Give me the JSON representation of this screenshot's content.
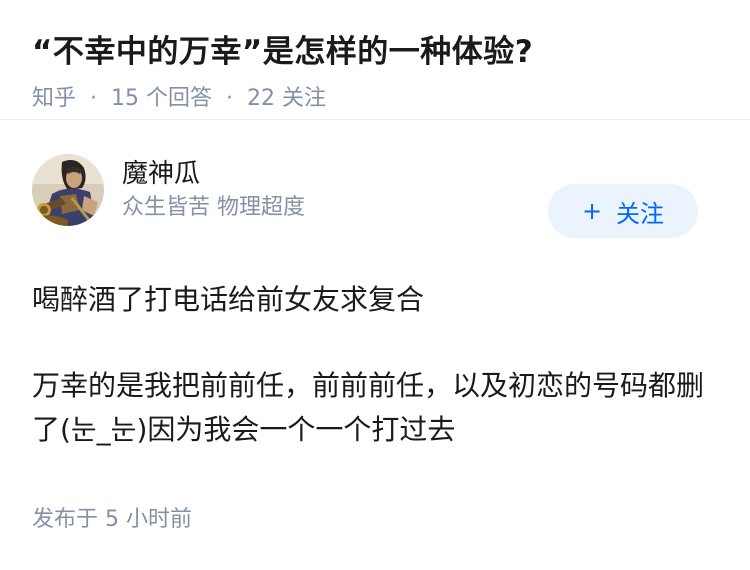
{
  "question": {
    "title": "“不幸中的万幸”是怎样的一种体验?",
    "source": "知乎",
    "answer_count": "15 个回答",
    "follow_count": "22 关注",
    "separator": "·"
  },
  "answer": {
    "author": {
      "name": "魔神瓜",
      "bio": "众生皆苦 物理超度",
      "avatar_icon": "avatar-warrior-illustration"
    },
    "follow_button": {
      "icon": "+",
      "label": "关注",
      "bg_color": "#ebf4fd",
      "text_color": "#0066ff"
    },
    "paragraphs": [
      "喝醉酒了打电话给前女友求复合",
      "万幸的是我把前前任，前前前任，以及初恋的号码都删了(눈_눈)因为我会一个一个打过去"
    ],
    "published": "发布于 5 小时前"
  }
}
